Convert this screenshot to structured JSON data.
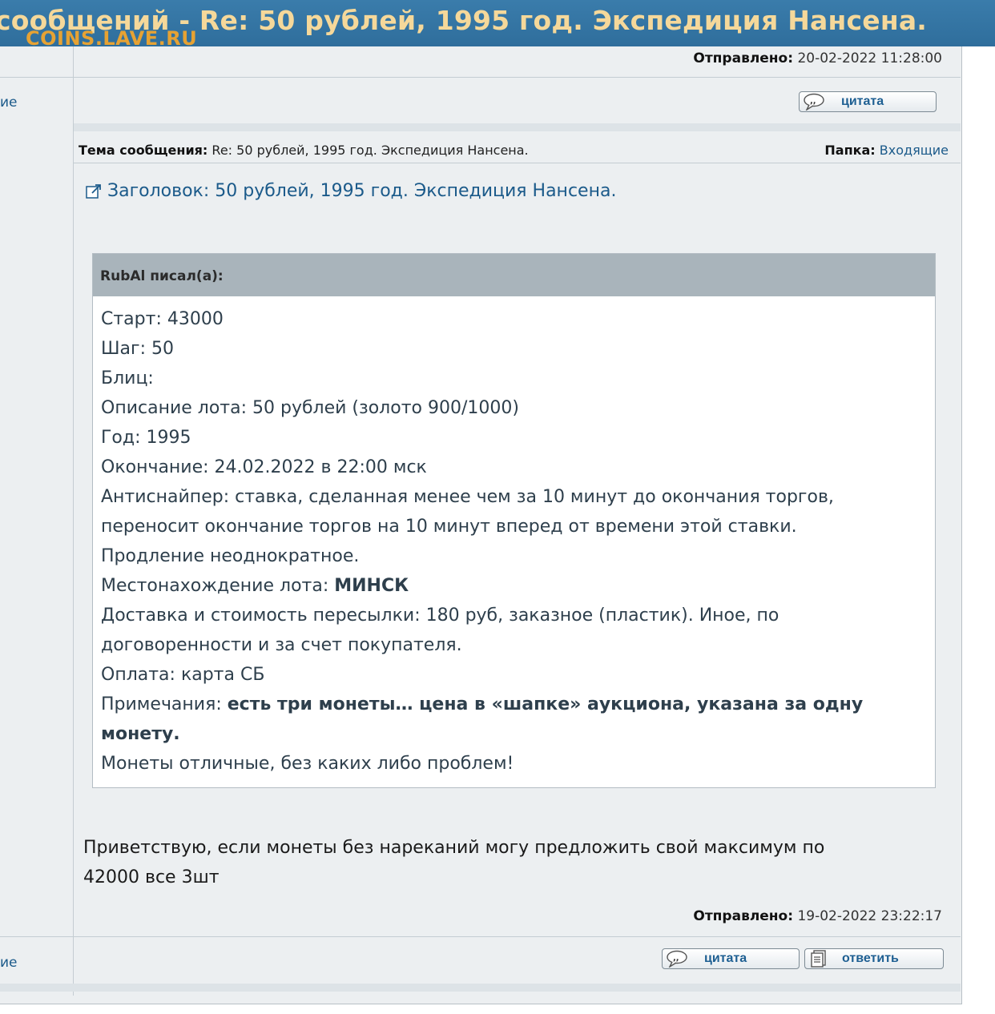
{
  "window": {
    "title": "сообщений - Re: 50 рублей, 1995 год. Экспедиция Нансена.",
    "watermark": "COINS.LAVE.RU"
  },
  "top_message": {
    "sent_label": "Отправлено:",
    "sent_value": "20-02-2022 11:28:00",
    "left_link": "ие",
    "quote_button": "цитата"
  },
  "message": {
    "topic_label": "Тема сообщения:",
    "topic_value": "Re: 50 рублей, 1995 год. Экспедиция Нансена.",
    "folder_label": "Папка:",
    "folder_value": "Входящие",
    "subject": "Заголовок: 50 рублей, 1995 год. Экспедиция Нансена.",
    "quote": {
      "author": "RubAl писал(а):",
      "lines": [
        "Старт: 43000",
        "Шаг: 50",
        "Блиц:",
        "Описание лота: 50 рублей (золото 900/1000)",
        "Год: 1995",
        "Окончание: 24.02.2022 в 22:00 мск",
        "Антиснайпер: ставка, сделанная менее чем за 10 минут до окончания торгов,",
        "переносит окончание торгов на 10 минут вперед от времени этой ставки.",
        "Продление неоднократное."
      ],
      "location_label": "Местонахождение лота: ",
      "location_value": "МИНСК",
      "delivery_line1": "Доставка и стоимость пересылки: 180 руб, заказное (пластик). Иное, по",
      "delivery_line2": "договоренности и за счет покупателя.",
      "payment": "Оплата: карта СБ",
      "notes_label": "Примечания: ",
      "notes_value_line1": "есть три монеты… цена в «шапке» аукциона, указана за одну",
      "notes_value_line2": "монету.",
      "final_line": "Монеты отличные, без каких либо проблем!"
    },
    "reply_line1": "Приветствую, если монеты без нареканий могу предложить свой максимум по",
    "reply_line2": "42000 все 3шт",
    "sent_label": "Отправлено:",
    "sent_value": "19-02-2022 23:22:17",
    "left_link": "ие",
    "quote_button": "цитата",
    "reply_button": "ответить"
  },
  "icons": {
    "quote_button": "speech-bubble-icon",
    "reply_button": "document-icon",
    "subject": "external-link-icon"
  },
  "colors": {
    "title_bar": "#2f6e9c",
    "title_text": "#f5d89a",
    "watermark": "#e6a233",
    "link": "#1b5a8a",
    "quote_header": "#a9b4bb"
  }
}
